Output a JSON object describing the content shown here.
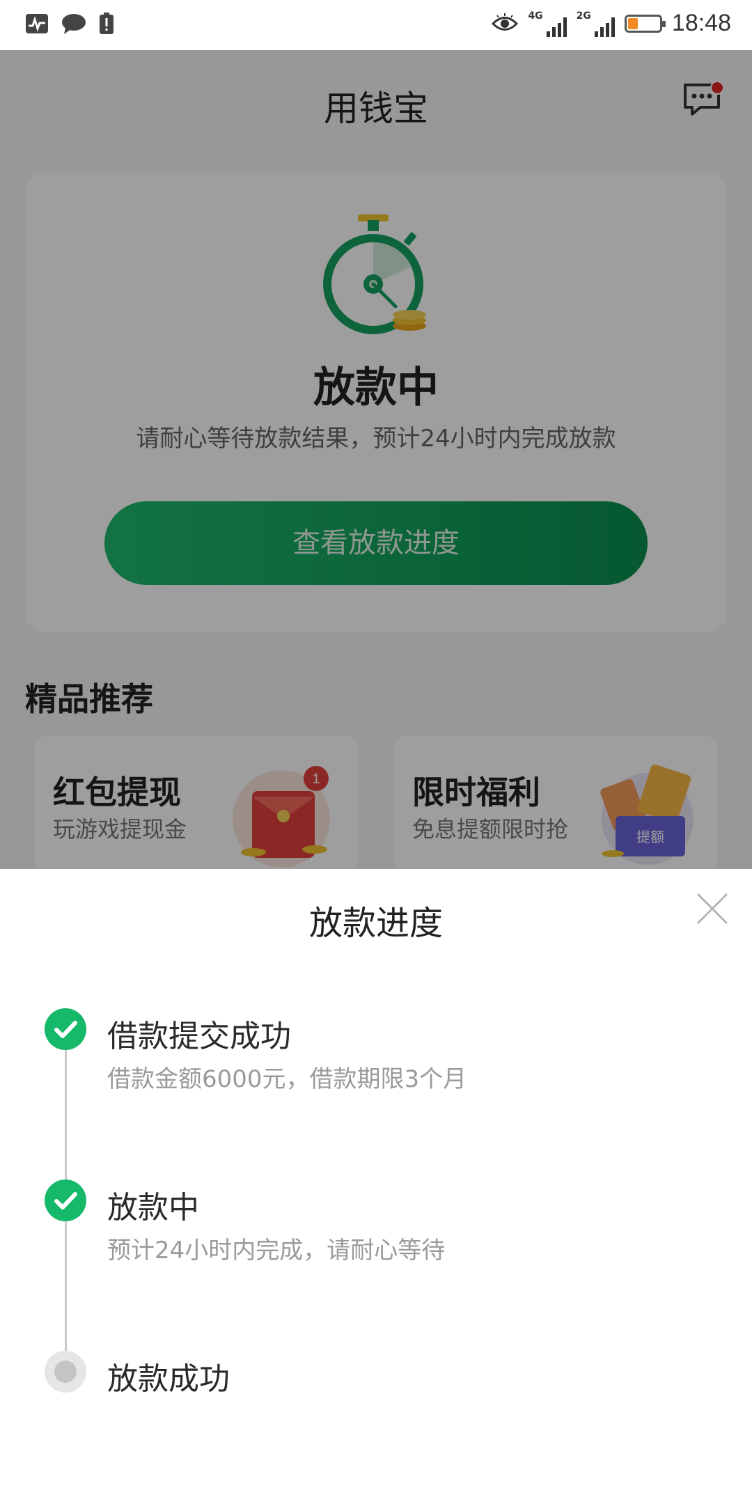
{
  "status_bar": {
    "time": "18:48",
    "net1": "4G",
    "net2": "2G"
  },
  "header": {
    "title": "用钱宝"
  },
  "card": {
    "status": "放款中",
    "subtitle": "请耐心等待放款结果，预计24小时内完成放款",
    "button_label": "查看放款进度"
  },
  "recommend": {
    "title": "精品推荐",
    "items": [
      {
        "title": "红包提现",
        "subtitle": "玩游戏提现金",
        "badge": "1"
      },
      {
        "title": "限时福利",
        "subtitle": "免息提额限时抢",
        "tag": "提额"
      }
    ]
  },
  "sheet": {
    "title": "放款进度",
    "steps": [
      {
        "title": "借款提交成功",
        "desc": "借款金额6000元，借款期限3个月",
        "state": "done"
      },
      {
        "title": "放款中",
        "desc": "预计24小时内完成，请耐心等待",
        "state": "done"
      },
      {
        "title": "放款成功",
        "desc": "",
        "state": "pending"
      }
    ]
  },
  "colors": {
    "accent": "#16b86a",
    "button_start": "#1fba6c",
    "button_end": "#0a8f4f",
    "badge": "#e02424"
  }
}
